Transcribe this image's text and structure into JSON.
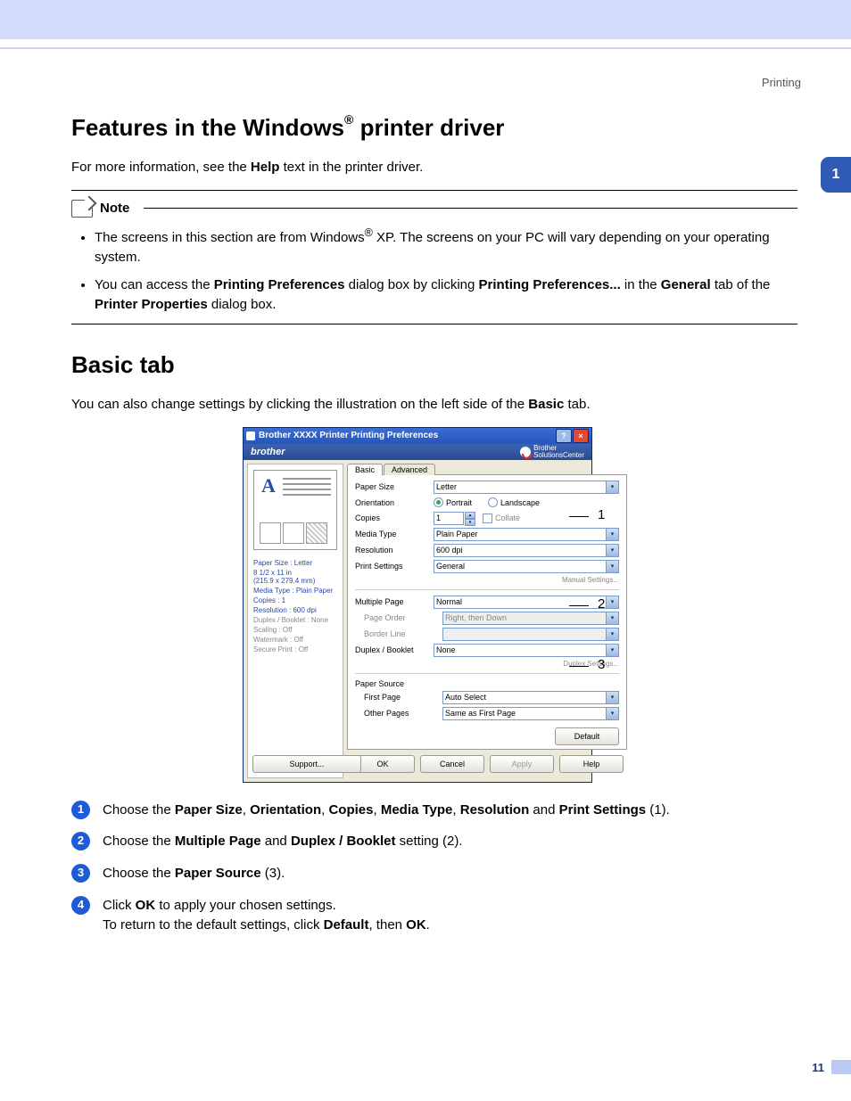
{
  "sectionHeader": "Printing",
  "sideTab": "1",
  "h1_a": "Features in the Windows",
  "h1_sup": "®",
  "h1_b": " printer driver",
  "intro_a": "For more information, see the ",
  "intro_b": "Help",
  "intro_c": " text in the printer driver.",
  "noteTitle": "Note",
  "note1_a": "The screens in this section are from Windows",
  "note1_sup": "®",
  "note1_b": " XP. The screens on your PC will vary depending on your operating system.",
  "note2_a": "You can access the ",
  "note2_b": "Printing Preferences",
  "note2_c": " dialog box by clicking ",
  "note2_d": "Printing Preferences...",
  "note2_e": " in the ",
  "note2_f": "General",
  "note2_g": " tab of the ",
  "note2_h": "Printer Properties",
  "note2_i": " dialog box.",
  "h2": "Basic tab",
  "desc_a": "You can also change settings by clicking the illustration on the left side of the ",
  "desc_b": "Basic",
  "desc_c": " tab.",
  "dlg": {
    "title": "Brother XXXX  Printer Printing Preferences",
    "help": "?",
    "close": "×",
    "brand": "brother",
    "sc": "Brother\nSolutionsCenter",
    "tabBasic": "Basic",
    "tabAdvanced": "Advanced",
    "lp": {
      "paperSize": "Paper Size : Letter",
      "dims": "8 1/2 x 11 in\n(215.9 x 279.4 mm)",
      "media": "Media Type : Plain Paper",
      "copies": "Copies : 1",
      "res": "Resolution : 600 dpi",
      "duplex": "Duplex / Booklet : None",
      "scaling": "Scaling : Off",
      "watermark": "Watermark : Off",
      "secure": "Secure Print : Off"
    },
    "labels": {
      "paperSize": "Paper Size",
      "orientation": "Orientation",
      "copies": "Copies",
      "mediaType": "Media Type",
      "resolution": "Resolution",
      "printSettings": "Print Settings",
      "multiplePage": "Multiple Page",
      "pageOrder": "Page Order",
      "borderLine": "Border Line",
      "duplex": "Duplex / Booklet",
      "paperSource": "Paper Source",
      "firstPage": "First Page",
      "otherPages": "Other Pages",
      "portrait": "Portrait",
      "landscape": "Landscape",
      "collate": "Collate",
      "manual": "Manual Settings...",
      "duplexSet": "Duplex Settings..."
    },
    "values": {
      "paperSize": "Letter",
      "copies": "1",
      "mediaType": "Plain Paper",
      "resolution": "600 dpi",
      "printSettings": "General",
      "multiplePage": "Normal",
      "pageOrder": "Right, then Down",
      "borderLine": "",
      "duplex": "None",
      "firstPage": "Auto Select",
      "otherPages": "Same as First Page"
    },
    "buttons": {
      "default": "Default",
      "support": "Support...",
      "ok": "OK",
      "cancel": "Cancel",
      "apply": "Apply",
      "helpBtn": "Help"
    }
  },
  "callouts": {
    "c1": "1",
    "c2": "2",
    "c3": "3"
  },
  "steps": {
    "s1": {
      "n": "1",
      "a": "Choose the ",
      "b": "Paper Size",
      "c": ", ",
      "d": "Orientation",
      "e": ", ",
      "f": "Copies",
      "g": ", ",
      "h": "Media Type",
      "i": ", ",
      "j": "Resolution",
      "k": " and ",
      "l": "Print Settings",
      "m": " (1)."
    },
    "s2": {
      "n": "2",
      "a": "Choose the ",
      "b": "Multiple Page",
      "c": " and ",
      "d": "Duplex / Booklet",
      "e": " setting (2)."
    },
    "s3": {
      "n": "3",
      "a": "Choose the ",
      "b": "Paper Source",
      "c": " (3)."
    },
    "s4": {
      "n": "4",
      "a": "Click ",
      "b": "OK",
      "c": " to apply your chosen settings.",
      "d": "To return to the default settings, click ",
      "e": "Default",
      "f": ", then ",
      "g": "OK",
      "h": "."
    }
  },
  "pageNum": "11"
}
